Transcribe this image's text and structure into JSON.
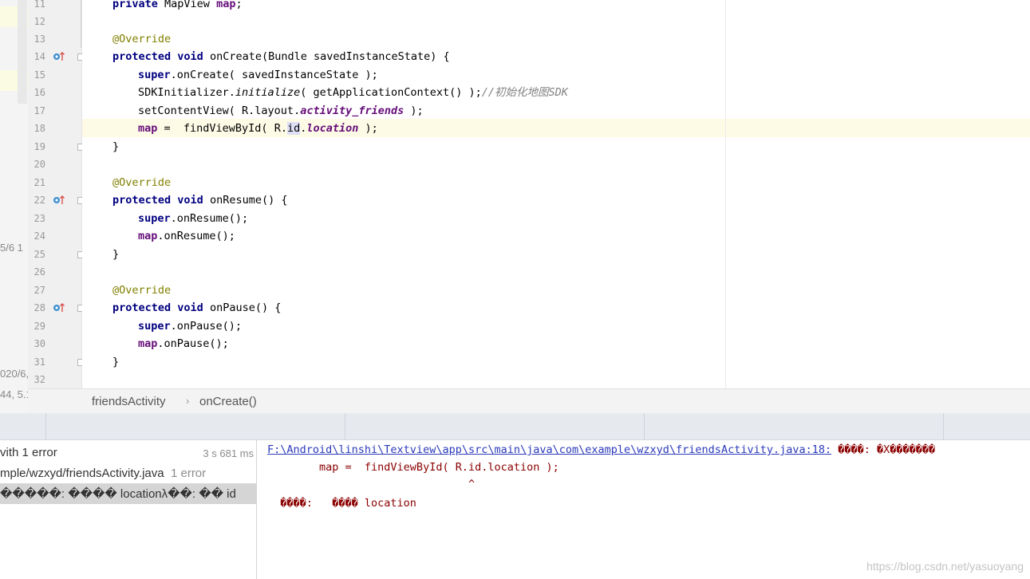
{
  "left_panel": {
    "snippets": [
      "5/6 1",
      "020/6,",
      "44, 5.1"
    ]
  },
  "gutter": {
    "line_numbers": [
      "11",
      "12",
      "13",
      "14",
      "15",
      "16",
      "17",
      "18",
      "19",
      "20",
      "21",
      "22",
      "23",
      "24",
      "25",
      "26",
      "27",
      "28",
      "29",
      "30",
      "31",
      "32"
    ]
  },
  "code": {
    "line11": {
      "kw": "private",
      "type": " MapView ",
      "field": "map",
      "end": ";"
    },
    "line13": "@Override",
    "line14": {
      "kw1": "protected",
      "kw2": "void",
      "rest": " onCreate(Bundle savedInstanceState) {"
    },
    "line15": {
      "kw": "super",
      "rest": ".onCreate( savedInstanceState );"
    },
    "line16": {
      "a": "SDKInitializer.",
      "method": "initialize",
      "b": "( getApplicationContext() );",
      "comment": "//初始化地图SDK"
    },
    "line17": {
      "a": "setContentView( R.layout.",
      "field": "activity_friends",
      "b": " );"
    },
    "line18": {
      "field": "map",
      "a": " =  findViewById( R.",
      "sel": "id",
      "b": ".",
      "field2": "location",
      "c": " );"
    },
    "line19": "}",
    "line21": "@Override",
    "line22": {
      "kw1": "protected",
      "kw2": "void",
      "rest": " onResume() {"
    },
    "line23": {
      "kw": "super",
      "rest": ".onResume();"
    },
    "line24": {
      "field": "map",
      "rest": ".onResume();"
    },
    "line25": "}",
    "line27": "@Override",
    "line28": {
      "kw1": "protected",
      "kw2": "void",
      "rest": " onPause() {"
    },
    "line29": {
      "kw": "super",
      "rest": ".onPause();"
    },
    "line30": {
      "field": "map",
      "rest": ".onPause();"
    },
    "line31": "}"
  },
  "breadcrumb": {
    "class_name": "friendsActivity",
    "separator": "›",
    "method_name": "onCreate()"
  },
  "build_tree": {
    "root_label": "vith 1 error",
    "root_time": "3 s 681 ms",
    "file_label": "mple/wzxyd/friendsActivity.java",
    "file_count": "1 error",
    "error_item": "�����:  ���� locationλ��: �� id"
  },
  "console": {
    "path_link": "F:\\Android\\linshi\\Textview\\app\\src\\main\\java\\com\\example\\wzxyd\\friendsActivity.java:18:",
    "path_msg": " ����: �X�������",
    "code_line": "        map =  findViewById( R.id.location );",
    "caret_line": "                               ^",
    "symbol_line": "  ����:   ���� location"
  },
  "watermark": "https://blog.csdn.net/yasuoyang",
  "colors": {
    "keyword": "#000080",
    "annotation": "#808000",
    "field": "#660e7a",
    "comment": "#808080",
    "highlight_line": "#fdfae6",
    "console_error": "#8b0000",
    "link": "#2b3aba"
  }
}
